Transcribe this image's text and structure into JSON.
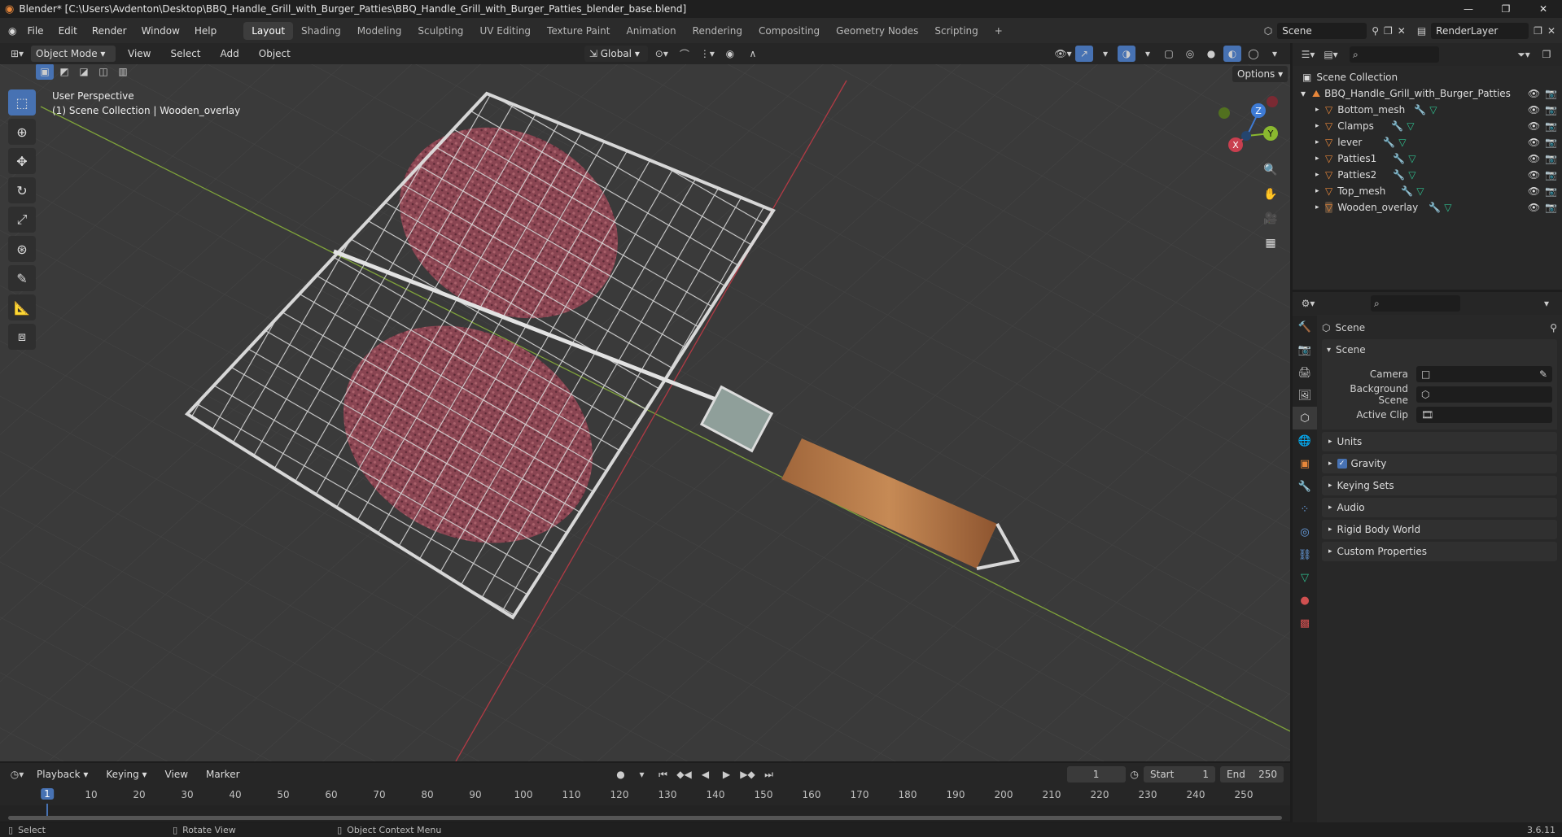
{
  "window": {
    "title": "Blender* [C:\\Users\\Avdenton\\Desktop\\BBQ_Handle_Grill_with_Burger_Patties\\BBQ_Handle_Grill_with_Burger_Patties_blender_base.blend]"
  },
  "menu": [
    "File",
    "Edit",
    "Render",
    "Window",
    "Help"
  ],
  "workspaces": [
    "Layout",
    "Shading",
    "Modeling",
    "Sculpting",
    "UV Editing",
    "Texture Paint",
    "Animation",
    "Rendering",
    "Compositing",
    "Geometry Nodes",
    "Scripting"
  ],
  "scene": {
    "name": "Scene",
    "view_layer": "RenderLayer"
  },
  "viewport_header": {
    "mode": "Object Mode",
    "menus": [
      "View",
      "Select",
      "Add",
      "Object"
    ],
    "orientation": "Global",
    "options": "Options"
  },
  "viewport": {
    "perspective": "User Perspective",
    "collection_info": "(1) Scene Collection | Wooden_overlay"
  },
  "outliner": {
    "root": "Scene Collection",
    "collection": "BBQ_Handle_Grill_with_Burger_Patties",
    "items": [
      "Bottom_mesh",
      "Clamps",
      "lever",
      "Patties1",
      "Patties2",
      "Top_mesh",
      "Wooden_overlay"
    ]
  },
  "properties": {
    "header": "Scene",
    "section": "Scene",
    "fields": [
      {
        "label": "Camera"
      },
      {
        "label": "Background Scene"
      },
      {
        "label": "Active Clip"
      }
    ],
    "panels": [
      "Units",
      "Gravity",
      "Keying Sets",
      "Audio",
      "Rigid Body World",
      "Custom Properties"
    ]
  },
  "timeline": {
    "menus": [
      "Playback",
      "Keying",
      "View",
      "Marker"
    ],
    "current_frame": "1",
    "start_label": "Start",
    "start": "1",
    "end_label": "End",
    "end": "250",
    "ticks": [
      "1",
      "10",
      "20",
      "30",
      "40",
      "50",
      "60",
      "70",
      "80",
      "90",
      "100",
      "110",
      "120",
      "130",
      "140",
      "150",
      "160",
      "170",
      "180",
      "190",
      "200",
      "210",
      "220",
      "230",
      "240",
      "250"
    ]
  },
  "status": {
    "select": "Select",
    "rotate": "Rotate View",
    "context": "Object Context Menu",
    "version": "3.6.11"
  },
  "gizmo": {
    "x": "X",
    "y": "Y",
    "z": "Z"
  },
  "colors": {
    "accent": "#4772b3",
    "x_axis": "#c93f4f",
    "y_axis": "#8ab82f",
    "z_axis": "#3e7bd5",
    "object_orange": "#e8873a",
    "modifier_blue": "#6aa2e6",
    "mesh_green": "#2fbf8f"
  }
}
